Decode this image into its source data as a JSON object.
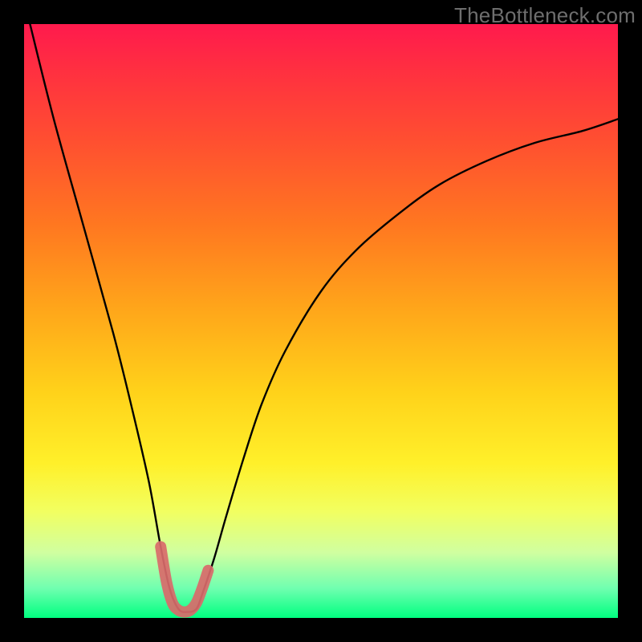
{
  "watermark": "TheBottleneck.com",
  "chart_data": {
    "type": "line",
    "title": "",
    "xlabel": "",
    "ylabel": "",
    "xlim": [
      0,
      100
    ],
    "ylim": [
      0,
      100
    ],
    "series": [
      {
        "name": "bottleneck-curve",
        "x": [
          1,
          5,
          10,
          15,
          18,
          21,
          23,
          24.5,
          26,
          27.5,
          29,
          30,
          32,
          34,
          37,
          40,
          44,
          50,
          56,
          63,
          70,
          78,
          86,
          94,
          100
        ],
        "values": [
          100,
          84,
          66,
          48,
          36,
          23,
          12,
          5,
          1.5,
          1,
          1.5,
          4,
          10,
          17,
          27,
          36,
          45,
          55,
          62,
          68,
          73,
          77,
          80,
          82,
          84
        ]
      },
      {
        "name": "highlight-valley",
        "x": [
          23,
          24,
          25,
          26,
          27,
          28,
          29,
          30,
          31
        ],
        "values": [
          12,
          6,
          2.5,
          1.3,
          1,
          1.3,
          2.5,
          5,
          8
        ]
      }
    ],
    "colors": {
      "curve": "#000000",
      "highlight": "#d96a6a"
    }
  }
}
